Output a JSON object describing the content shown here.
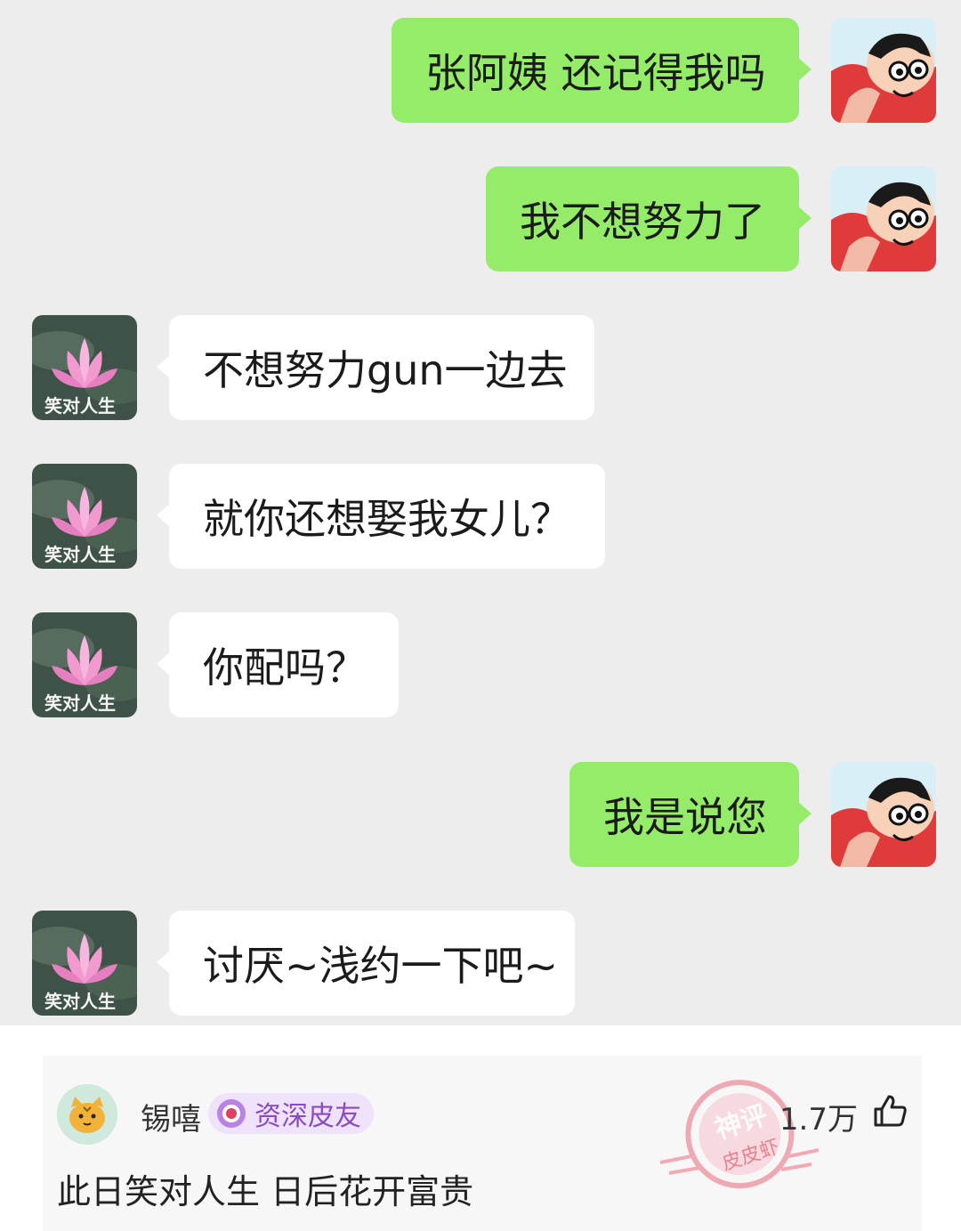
{
  "chat": {
    "messages": [
      {
        "side": "sent",
        "text": "张阿姨 还记得我吗"
      },
      {
        "side": "sent",
        "text": "我不想努力了"
      },
      {
        "side": "recv",
        "text": "不想努力gun一边去"
      },
      {
        "side": "recv",
        "text": "就你还想娶我女儿？"
      },
      {
        "side": "recv",
        "text": "你配吗？"
      },
      {
        "side": "sent",
        "text": "我是说您"
      },
      {
        "side": "recv",
        "text": "讨厌~浅约一下吧~"
      }
    ],
    "recv_avatar_caption": "笑对人生",
    "colors": {
      "sent_bubble": "#95ec69",
      "recv_bubble": "#ffffff",
      "background": "#ededed"
    }
  },
  "comment": {
    "username": "锡嘻",
    "badge": "资深皮友",
    "likes": "1.7万",
    "text": "此日笑对人生 日后花开富贵",
    "stamp_line1": "神评",
    "stamp_line2": "皮皮虾"
  }
}
